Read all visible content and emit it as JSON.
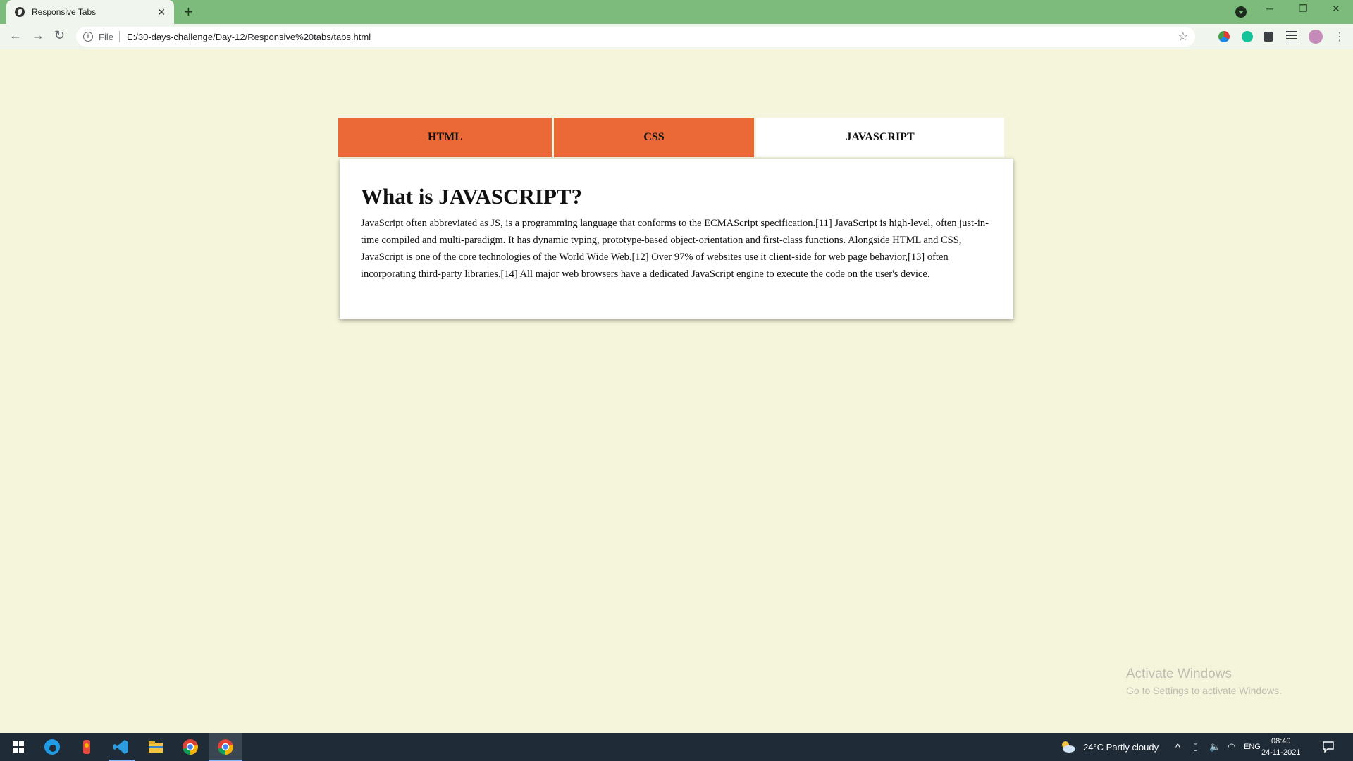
{
  "browser": {
    "tab_title": "Responsive Tabs",
    "tab_close": "✕",
    "new_tab": "+",
    "url_scheme": "File",
    "url": "E:/30-days-challenge/Day-12/Responsive%20tabs/tabs.html",
    "window_controls": {
      "minimize": "─",
      "restore": "❐",
      "close": "✕"
    },
    "nav": {
      "back": "←",
      "forward": "→",
      "reload": "↻"
    },
    "star": "☆",
    "extensions": [
      "color-extension-icon",
      "grammarly-icon",
      "puzzle-extensions-icon",
      "reading-list-icon",
      "profile-avatar"
    ],
    "menu": "⋮"
  },
  "page": {
    "tabs": [
      {
        "label": "HTML",
        "active": false
      },
      {
        "label": "CSS",
        "active": false
      },
      {
        "label": "JAVASCRIPT",
        "active": true
      }
    ],
    "panel": {
      "heading": "What is JAVASCRIPT?",
      "body": "JavaScript often abbreviated as JS, is a programming language that conforms to the ECMAScript specification.[11] JavaScript is high-level, often just-in-time compiled and multi-paradigm. It has dynamic typing, prototype-based object-orientation and first-class functions. Alongside HTML and CSS, JavaScript is one of the core technologies of the World Wide Web.[12] Over 97% of websites use it client-side for web page behavior,[13] often incorporating third-party libraries.[14] All major web browsers have a dedicated JavaScript engine to execute the code on the user's device."
    },
    "colors": {
      "background": "#f5f5dc",
      "tab_inactive": "#eb6937",
      "tab_active": "#ffffff"
    }
  },
  "watermark": {
    "line1": "Activate Windows",
    "line2": "Go to Settings to activate Windows."
  },
  "taskbar": {
    "apps": [
      "windows-start-icon",
      "edge-icon",
      "sketch-app-icon",
      "vscode-icon",
      "file-explorer-icon",
      "chrome-icon",
      "chrome-active-icon"
    ],
    "weather": "24°C  Partly cloudy",
    "language": "ENG",
    "time": "08:40",
    "date": "24-11-2021"
  }
}
